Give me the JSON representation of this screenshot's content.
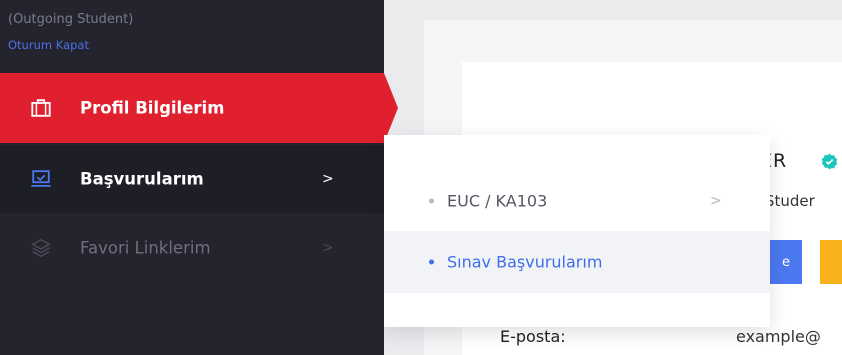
{
  "sidebar": {
    "user_role": "(Outgoing Student)",
    "logout_label": "Oturum Kapat",
    "items": [
      {
        "label": "Profil Bilgilerim",
        "icon": "briefcase-icon",
        "active": true
      },
      {
        "label": "Başvurularım",
        "icon": "laptop-icon",
        "chevron": ">",
        "expanded": true
      },
      {
        "label": "Favori Linklerim",
        "icon": "layers-icon",
        "chevron": ">",
        "muted": true
      }
    ]
  },
  "submenu": {
    "items": [
      {
        "label": "EUC / KA103",
        "chevron": ">"
      },
      {
        "label": "Sınav Başvurularım",
        "active": true
      }
    ]
  },
  "profile": {
    "name_fragment": "ER",
    "subtitle_fragment": "j Studer",
    "button_fragment": "e",
    "email_label": "E-posta:",
    "email_value_fragment": "example@"
  },
  "colors": {
    "sidebar_bg": "#24242e",
    "active_red": "#e0202f",
    "accent_blue": "#3f6ee8",
    "yellow": "#f7b21c",
    "verified_teal": "#1bc5bd"
  }
}
